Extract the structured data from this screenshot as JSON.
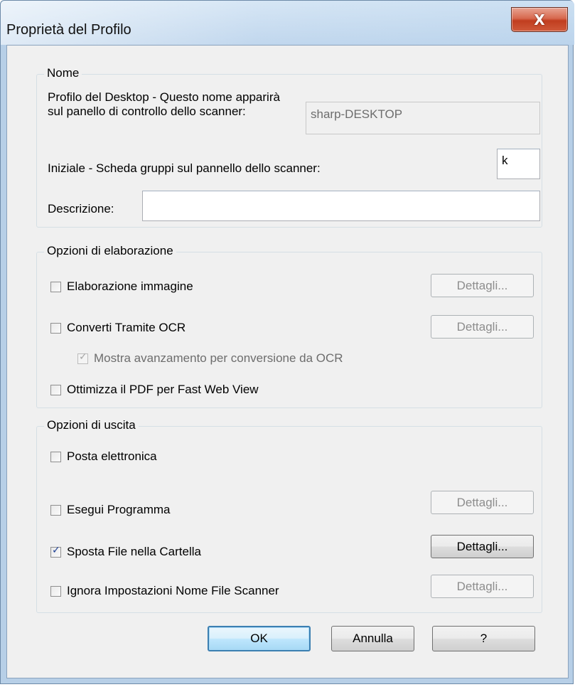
{
  "window": {
    "title": "Proprietà del Profilo",
    "close_glyph": "X"
  },
  "nome_group": {
    "title": "Nome",
    "desktop_profile_label": "Profilo del Desktop - Questo nome apparirà sul panello di controllo dello scanner:",
    "desktop_profile_value": "sharp-DESKTOP",
    "initial_label": "Iniziale - Scheda gruppi sul pannello dello scanner:",
    "initial_value": "k",
    "description_label": "Descrizione:",
    "description_value": ""
  },
  "elaborazione_group": {
    "title": "Opzioni di elaborazione",
    "image_processing": {
      "label": "Elaborazione immagine",
      "checked": false,
      "details": "Dettagli..."
    },
    "ocr": {
      "label": "Converti Tramite OCR",
      "checked": false,
      "details": "Dettagli..."
    },
    "ocr_progress": {
      "label": "Mostra avanzamento per conversione da OCR",
      "checked": true
    },
    "fast_web_view": {
      "label": "Ottimizza il PDF per Fast Web View",
      "checked": false
    }
  },
  "uscita_group": {
    "title": "Opzioni di uscita",
    "email": {
      "label": "Posta elettronica",
      "checked": false
    },
    "run_program": {
      "label": "Esegui Programma",
      "checked": false,
      "details": "Dettagli..."
    },
    "move_file": {
      "label": "Sposta File nella Cartella",
      "checked": true,
      "details": "Dettagli..."
    },
    "ignore_names": {
      "label": "Ignora Impostazioni Nome File Scanner",
      "checked": false,
      "details": "Dettagli..."
    }
  },
  "buttons": {
    "ok": "OK",
    "cancel": "Annulla",
    "help": "?"
  }
}
